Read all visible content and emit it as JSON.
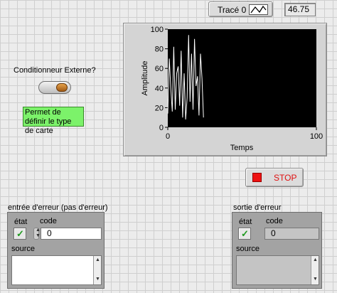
{
  "graph": {
    "legend_label": "Tracé 0",
    "legend_icon": "line-plot-icon",
    "value_indicator": "46.75",
    "ylabel": "Amplitude",
    "xlabel": "Temps"
  },
  "chart_data": {
    "type": "line",
    "xlabel": "Temps",
    "ylabel": "Amplitude",
    "xlim": [
      0,
      100
    ],
    "ylim": [
      0,
      100
    ],
    "xticks": [
      "0",
      "100"
    ],
    "yticks": [
      "0",
      "20",
      "40",
      "60",
      "80",
      "100"
    ],
    "background": "#000000",
    "line_color": "#ffffff",
    "grid": false,
    "x": [
      0,
      1,
      2,
      3,
      4,
      5,
      6,
      7,
      8,
      9,
      10,
      11,
      12,
      13,
      14,
      15,
      16,
      17,
      18,
      19,
      20,
      21,
      22,
      23,
      24
    ],
    "y": [
      14,
      70,
      40,
      16,
      82,
      18,
      55,
      62,
      22,
      78,
      10,
      55,
      8,
      30,
      94,
      26,
      75,
      18,
      90,
      42,
      52,
      12,
      75,
      50,
      10
    ]
  },
  "controls": {
    "stop_label": "STOP",
    "conditionneur_label": "Conditionneur Externe?",
    "note_text": "Permet de définir le type de carte"
  },
  "error_in": {
    "title": "entrée d'erreur (pas d'erreur)",
    "status_label": "état",
    "code_label": "code",
    "code_value": "0",
    "source_label": "source"
  },
  "error_out": {
    "title": "sortie d'erreur",
    "status_label": "état",
    "code_label": "code",
    "code_value": "0",
    "source_label": "source"
  },
  "colors": {
    "stop_square": "#ee1111",
    "note_bg": "#7cf26a",
    "status_ok": "#1f9a1f"
  }
}
